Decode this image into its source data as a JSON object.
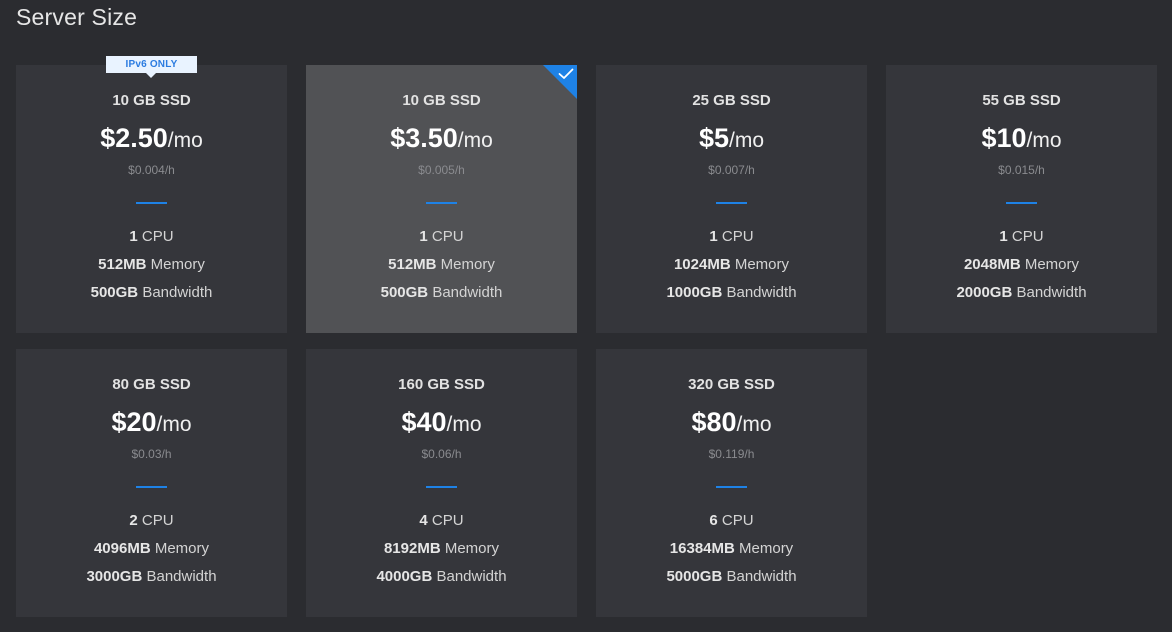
{
  "section": {
    "title": "Server Size"
  },
  "colors": {
    "accent": "#1e82e6",
    "card_bg": "#35363b",
    "card_selected_bg": "#515255",
    "page_bg": "#2b2c30"
  },
  "plans": [
    {
      "badge": "IPv6 ONLY",
      "selected": false,
      "storage": "10 GB SSD",
      "price": "$2.50",
      "price_unit": "/mo",
      "hourly": "$0.004/h",
      "cpu_value": "1",
      "cpu_label": "CPU",
      "memory_value": "512MB",
      "memory_label": "Memory",
      "bandwidth_value": "500GB",
      "bandwidth_label": "Bandwidth"
    },
    {
      "badge": "",
      "selected": true,
      "storage": "10 GB SSD",
      "price": "$3.50",
      "price_unit": "/mo",
      "hourly": "$0.005/h",
      "cpu_value": "1",
      "cpu_label": "CPU",
      "memory_value": "512MB",
      "memory_label": "Memory",
      "bandwidth_value": "500GB",
      "bandwidth_label": "Bandwidth"
    },
    {
      "badge": "",
      "selected": false,
      "storage": "25 GB SSD",
      "price": "$5",
      "price_unit": "/mo",
      "hourly": "$0.007/h",
      "cpu_value": "1",
      "cpu_label": "CPU",
      "memory_value": "1024MB",
      "memory_label": "Memory",
      "bandwidth_value": "1000GB",
      "bandwidth_label": "Bandwidth"
    },
    {
      "badge": "",
      "selected": false,
      "storage": "55 GB SSD",
      "price": "$10",
      "price_unit": "/mo",
      "hourly": "$0.015/h",
      "cpu_value": "1",
      "cpu_label": "CPU",
      "memory_value": "2048MB",
      "memory_label": "Memory",
      "bandwidth_value": "2000GB",
      "bandwidth_label": "Bandwidth"
    },
    {
      "badge": "",
      "selected": false,
      "storage": "80 GB SSD",
      "price": "$20",
      "price_unit": "/mo",
      "hourly": "$0.03/h",
      "cpu_value": "2",
      "cpu_label": "CPU",
      "memory_value": "4096MB",
      "memory_label": "Memory",
      "bandwidth_value": "3000GB",
      "bandwidth_label": "Bandwidth"
    },
    {
      "badge": "",
      "selected": false,
      "storage": "160 GB SSD",
      "price": "$40",
      "price_unit": "/mo",
      "hourly": "$0.06/h",
      "cpu_value": "4",
      "cpu_label": "CPU",
      "memory_value": "8192MB",
      "memory_label": "Memory",
      "bandwidth_value": "4000GB",
      "bandwidth_label": "Bandwidth"
    },
    {
      "badge": "",
      "selected": false,
      "storage": "320 GB SSD",
      "price": "$80",
      "price_unit": "/mo",
      "hourly": "$0.119/h",
      "cpu_value": "6",
      "cpu_label": "CPU",
      "memory_value": "16384MB",
      "memory_label": "Memory",
      "bandwidth_value": "5000GB",
      "bandwidth_label": "Bandwidth"
    }
  ]
}
